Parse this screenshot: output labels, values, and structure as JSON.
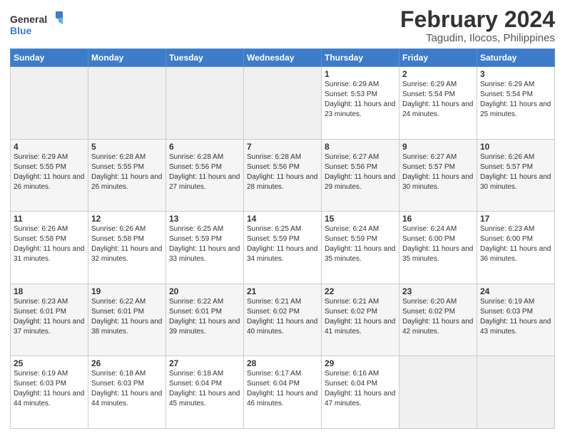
{
  "logo": {
    "line1": "General",
    "line2": "Blue"
  },
  "title": "February 2024",
  "subtitle": "Tagudin, Ilocos, Philippines",
  "days_of_week": [
    "Sunday",
    "Monday",
    "Tuesday",
    "Wednesday",
    "Thursday",
    "Friday",
    "Saturday"
  ],
  "weeks": [
    [
      {
        "day": "",
        "sunrise": "",
        "sunset": "",
        "daylight": ""
      },
      {
        "day": "",
        "sunrise": "",
        "sunset": "",
        "daylight": ""
      },
      {
        "day": "",
        "sunrise": "",
        "sunset": "",
        "daylight": ""
      },
      {
        "day": "",
        "sunrise": "",
        "sunset": "",
        "daylight": ""
      },
      {
        "day": "1",
        "sunrise": "Sunrise: 6:29 AM",
        "sunset": "Sunset: 5:53 PM",
        "daylight": "Daylight: 11 hours and 23 minutes."
      },
      {
        "day": "2",
        "sunrise": "Sunrise: 6:29 AM",
        "sunset": "Sunset: 5:54 PM",
        "daylight": "Daylight: 11 hours and 24 minutes."
      },
      {
        "day": "3",
        "sunrise": "Sunrise: 6:29 AM",
        "sunset": "Sunset: 5:54 PM",
        "daylight": "Daylight: 11 hours and 25 minutes."
      }
    ],
    [
      {
        "day": "4",
        "sunrise": "Sunrise: 6:29 AM",
        "sunset": "Sunset: 5:55 PM",
        "daylight": "Daylight: 11 hours and 26 minutes."
      },
      {
        "day": "5",
        "sunrise": "Sunrise: 6:28 AM",
        "sunset": "Sunset: 5:55 PM",
        "daylight": "Daylight: 11 hours and 26 minutes."
      },
      {
        "day": "6",
        "sunrise": "Sunrise: 6:28 AM",
        "sunset": "Sunset: 5:56 PM",
        "daylight": "Daylight: 11 hours and 27 minutes."
      },
      {
        "day": "7",
        "sunrise": "Sunrise: 6:28 AM",
        "sunset": "Sunset: 5:56 PM",
        "daylight": "Daylight: 11 hours and 28 minutes."
      },
      {
        "day": "8",
        "sunrise": "Sunrise: 6:27 AM",
        "sunset": "Sunset: 5:56 PM",
        "daylight": "Daylight: 11 hours and 29 minutes."
      },
      {
        "day": "9",
        "sunrise": "Sunrise: 6:27 AM",
        "sunset": "Sunset: 5:57 PM",
        "daylight": "Daylight: 11 hours and 30 minutes."
      },
      {
        "day": "10",
        "sunrise": "Sunrise: 6:26 AM",
        "sunset": "Sunset: 5:57 PM",
        "daylight": "Daylight: 11 hours and 30 minutes."
      }
    ],
    [
      {
        "day": "11",
        "sunrise": "Sunrise: 6:26 AM",
        "sunset": "Sunset: 5:58 PM",
        "daylight": "Daylight: 11 hours and 31 minutes."
      },
      {
        "day": "12",
        "sunrise": "Sunrise: 6:26 AM",
        "sunset": "Sunset: 5:58 PM",
        "daylight": "Daylight: 11 hours and 32 minutes."
      },
      {
        "day": "13",
        "sunrise": "Sunrise: 6:25 AM",
        "sunset": "Sunset: 5:59 PM",
        "daylight": "Daylight: 11 hours and 33 minutes."
      },
      {
        "day": "14",
        "sunrise": "Sunrise: 6:25 AM",
        "sunset": "Sunset: 5:59 PM",
        "daylight": "Daylight: 11 hours and 34 minutes."
      },
      {
        "day": "15",
        "sunrise": "Sunrise: 6:24 AM",
        "sunset": "Sunset: 5:59 PM",
        "daylight": "Daylight: 11 hours and 35 minutes."
      },
      {
        "day": "16",
        "sunrise": "Sunrise: 6:24 AM",
        "sunset": "Sunset: 6:00 PM",
        "daylight": "Daylight: 11 hours and 35 minutes."
      },
      {
        "day": "17",
        "sunrise": "Sunrise: 6:23 AM",
        "sunset": "Sunset: 6:00 PM",
        "daylight": "Daylight: 11 hours and 36 minutes."
      }
    ],
    [
      {
        "day": "18",
        "sunrise": "Sunrise: 6:23 AM",
        "sunset": "Sunset: 6:01 PM",
        "daylight": "Daylight: 11 hours and 37 minutes."
      },
      {
        "day": "19",
        "sunrise": "Sunrise: 6:22 AM",
        "sunset": "Sunset: 6:01 PM",
        "daylight": "Daylight: 11 hours and 38 minutes."
      },
      {
        "day": "20",
        "sunrise": "Sunrise: 6:22 AM",
        "sunset": "Sunset: 6:01 PM",
        "daylight": "Daylight: 11 hours and 39 minutes."
      },
      {
        "day": "21",
        "sunrise": "Sunrise: 6:21 AM",
        "sunset": "Sunset: 6:02 PM",
        "daylight": "Daylight: 11 hours and 40 minutes."
      },
      {
        "day": "22",
        "sunrise": "Sunrise: 6:21 AM",
        "sunset": "Sunset: 6:02 PM",
        "daylight": "Daylight: 11 hours and 41 minutes."
      },
      {
        "day": "23",
        "sunrise": "Sunrise: 6:20 AM",
        "sunset": "Sunset: 6:02 PM",
        "daylight": "Daylight: 11 hours and 42 minutes."
      },
      {
        "day": "24",
        "sunrise": "Sunrise: 6:19 AM",
        "sunset": "Sunset: 6:03 PM",
        "daylight": "Daylight: 11 hours and 43 minutes."
      }
    ],
    [
      {
        "day": "25",
        "sunrise": "Sunrise: 6:19 AM",
        "sunset": "Sunset: 6:03 PM",
        "daylight": "Daylight: 11 hours and 44 minutes."
      },
      {
        "day": "26",
        "sunrise": "Sunrise: 6:18 AM",
        "sunset": "Sunset: 6:03 PM",
        "daylight": "Daylight: 11 hours and 44 minutes."
      },
      {
        "day": "27",
        "sunrise": "Sunrise: 6:18 AM",
        "sunset": "Sunset: 6:04 PM",
        "daylight": "Daylight: 11 hours and 45 minutes."
      },
      {
        "day": "28",
        "sunrise": "Sunrise: 6:17 AM",
        "sunset": "Sunset: 6:04 PM",
        "daylight": "Daylight: 11 hours and 46 minutes."
      },
      {
        "day": "29",
        "sunrise": "Sunrise: 6:16 AM",
        "sunset": "Sunset: 6:04 PM",
        "daylight": "Daylight: 11 hours and 47 minutes."
      },
      {
        "day": "",
        "sunrise": "",
        "sunset": "",
        "daylight": ""
      },
      {
        "day": "",
        "sunrise": "",
        "sunset": "",
        "daylight": ""
      }
    ]
  ]
}
